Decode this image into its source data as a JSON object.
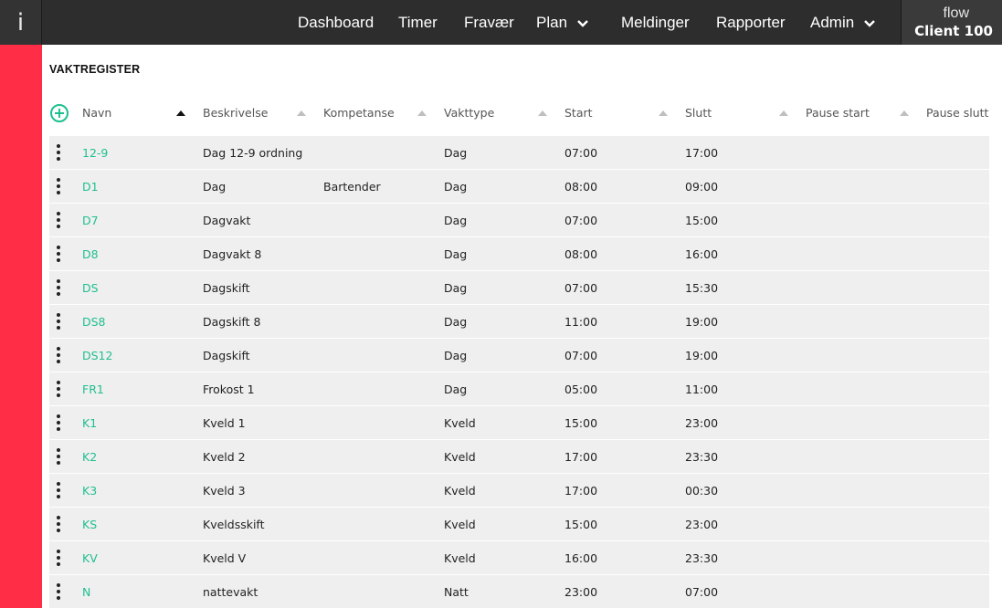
{
  "app": {
    "logo_text": "i",
    "client_label": "flow",
    "client_name": "Client 100"
  },
  "nav": {
    "items": [
      {
        "label": "Dashboard",
        "has_dropdown": false
      },
      {
        "label": "Timer",
        "has_dropdown": false
      },
      {
        "label": "Fravær",
        "has_dropdown": false
      },
      {
        "label": "Plan",
        "has_dropdown": true
      },
      {
        "label": "Meldinger",
        "has_dropdown": false
      },
      {
        "label": "Rapporter",
        "has_dropdown": false
      },
      {
        "label": "Admin",
        "has_dropdown": true
      }
    ]
  },
  "colors": {
    "accent_red": "#ff2d46",
    "link_green": "#1fbf8f",
    "topbar": "#2d2d2d",
    "row_bg": "#efefef"
  },
  "icons": {
    "add": "plus-circle-icon",
    "row_menu": "vertical-dots-icon",
    "sort": "sort-triangle-icon",
    "dropdown": "chevron-down-icon"
  },
  "page": {
    "title": "VAKTREGISTER"
  },
  "table": {
    "sort_column": "Navn",
    "columns": [
      "Navn",
      "Beskrivelse",
      "Kompetanse",
      "Vakttype",
      "Start",
      "Slutt",
      "Pause start",
      "Pause slutt"
    ],
    "rows": [
      {
        "navn": "12-9",
        "beskrivelse": "Dag 12-9 ordning",
        "kompetanse": "",
        "vakttype": "Dag",
        "start": "07:00",
        "slutt": "17:00"
      },
      {
        "navn": "D1",
        "beskrivelse": "Dag",
        "kompetanse": "Bartender",
        "vakttype": "Dag",
        "start": "08:00",
        "slutt": "09:00"
      },
      {
        "navn": "D7",
        "beskrivelse": "Dagvakt",
        "kompetanse": "",
        "vakttype": "Dag",
        "start": "07:00",
        "slutt": "15:00"
      },
      {
        "navn": "D8",
        "beskrivelse": "Dagvakt 8",
        "kompetanse": "",
        "vakttype": "Dag",
        "start": "08:00",
        "slutt": "16:00"
      },
      {
        "navn": "DS",
        "beskrivelse": "Dagskift",
        "kompetanse": "",
        "vakttype": "Dag",
        "start": "07:00",
        "slutt": "15:30"
      },
      {
        "navn": "DS8",
        "beskrivelse": "Dagskift 8",
        "kompetanse": "",
        "vakttype": "Dag",
        "start": "11:00",
        "slutt": "19:00"
      },
      {
        "navn": "DS12",
        "beskrivelse": "Dagskift",
        "kompetanse": "",
        "vakttype": "Dag",
        "start": "07:00",
        "slutt": "19:00"
      },
      {
        "navn": "FR1",
        "beskrivelse": "Frokost 1",
        "kompetanse": "",
        "vakttype": "Dag",
        "start": "05:00",
        "slutt": "11:00"
      },
      {
        "navn": "K1",
        "beskrivelse": "Kveld 1",
        "kompetanse": "",
        "vakttype": "Kveld",
        "start": "15:00",
        "slutt": "23:00"
      },
      {
        "navn": "K2",
        "beskrivelse": "Kveld 2",
        "kompetanse": "",
        "vakttype": "Kveld",
        "start": "17:00",
        "slutt": "23:30"
      },
      {
        "navn": "K3",
        "beskrivelse": "Kveld 3",
        "kompetanse": "",
        "vakttype": "Kveld",
        "start": "17:00",
        "slutt": "00:30"
      },
      {
        "navn": "KS",
        "beskrivelse": "Kveldsskift",
        "kompetanse": "",
        "vakttype": "Kveld",
        "start": "15:00",
        "slutt": "23:00"
      },
      {
        "navn": "KV",
        "beskrivelse": "Kveld V",
        "kompetanse": "",
        "vakttype": "Kveld",
        "start": "16:00",
        "slutt": "23:30"
      },
      {
        "navn": "N",
        "beskrivelse": "nattevakt",
        "kompetanse": "",
        "vakttype": "Natt",
        "start": "23:00",
        "slutt": "07:00"
      }
    ]
  }
}
